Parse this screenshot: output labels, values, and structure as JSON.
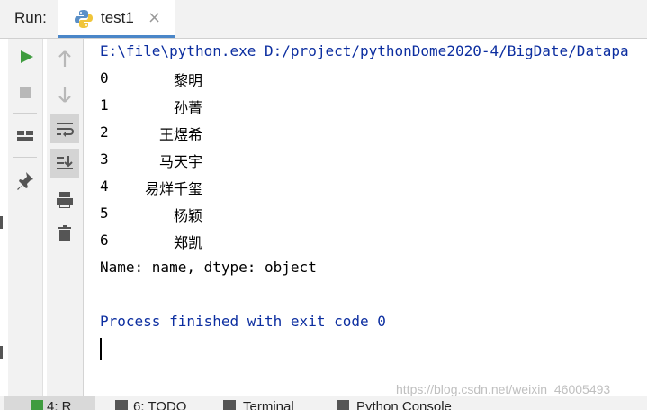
{
  "run_panel": {
    "label": "Run:",
    "tab": {
      "title": "test1",
      "close_glyph": "×",
      "icon": "python-icon"
    }
  },
  "toolbar_left": [
    {
      "name": "rerun-icon",
      "color": "#3f9c3f"
    },
    {
      "name": "stop-icon",
      "color": "#b8b8b8"
    },
    {
      "name": "layout-icon",
      "color": "#555555"
    },
    {
      "name": "pin-icon",
      "color": "#555555"
    }
  ],
  "toolbar_right": [
    {
      "name": "up-arrow-icon"
    },
    {
      "name": "down-arrow-icon"
    },
    {
      "name": "soft-wrap-icon",
      "active": true
    },
    {
      "name": "scroll-to-end-icon",
      "active": true
    },
    {
      "name": "print-icon"
    },
    {
      "name": "trash-icon"
    }
  ],
  "console": {
    "command": "E:\\file\\python.exe D:/project/pythonDome2020-4/BigDate/Datapa",
    "rows": [
      {
        "index": "0",
        "name": "黎明"
      },
      {
        "index": "1",
        "name": "孙菁"
      },
      {
        "index": "2",
        "name": "王煜希"
      },
      {
        "index": "3",
        "name": "马天宇"
      },
      {
        "index": "4",
        "name": "易烊千玺"
      },
      {
        "index": "5",
        "name": "杨颖"
      },
      {
        "index": "6",
        "name": "郑凯"
      }
    ],
    "dtype_line": "Name: name, dtype: object",
    "exit_line": "Process finished with exit code 0",
    "command_color": "#0c2ea0"
  },
  "bottom_tabs": [
    {
      "label": "4: R"
    },
    {
      "label": "6: TODO"
    },
    {
      "label": "Terminal"
    },
    {
      "label": "Python Console"
    }
  ],
  "watermark": "https://blog.csdn.net/weixin_46005493"
}
